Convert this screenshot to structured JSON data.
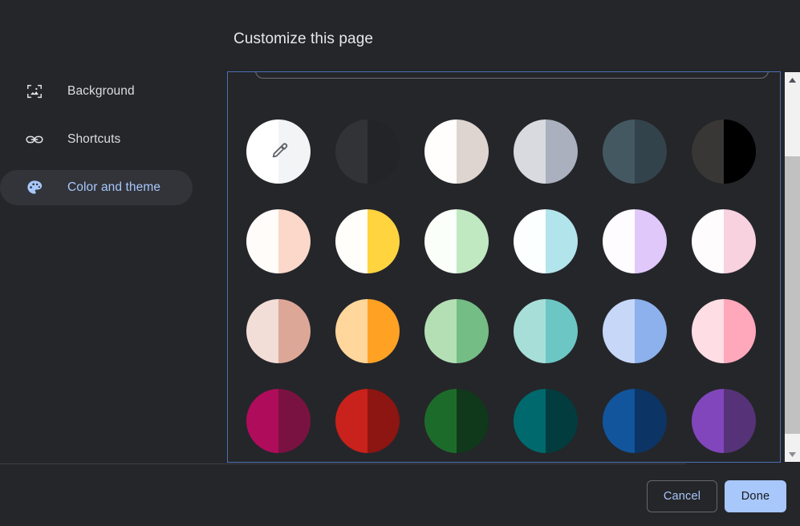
{
  "dialog": {
    "title": "Customize this page",
    "background": "#25262a"
  },
  "sidebar": {
    "items": [
      {
        "label": "Background",
        "icon": "image-frame-icon",
        "selected": false
      },
      {
        "label": "Shortcuts",
        "icon": "link-icon",
        "selected": false
      },
      {
        "label": "Color and theme",
        "icon": "palette-icon",
        "selected": true
      }
    ]
  },
  "swatches": {
    "accent_color": "#a8c7fa",
    "rows": [
      [
        {
          "name": "custom-color-picker",
          "left": "#ffffff",
          "right": "#f3f4f6",
          "icon": "eyedropper-icon",
          "outlined": false
        },
        {
          "name": "dark-grey-theme",
          "left": "#313337",
          "right": "#232428",
          "icon": "",
          "outlined": false
        },
        {
          "name": "white-beige-theme",
          "left": "#fffefd",
          "right": "#ded5d0",
          "icon": "",
          "outlined": false
        },
        {
          "name": "light-grey-theme",
          "left": "#d8dae0",
          "right": "#aab0bd",
          "icon": "",
          "outlined": false
        },
        {
          "name": "slate-blue-theme",
          "left": "#445862",
          "right": "#33434c",
          "icon": "",
          "outlined": false
        },
        {
          "name": "black-theme",
          "left": "#383735",
          "right": "#000000",
          "icon": "",
          "outlined": true
        }
      ],
      [
        {
          "name": "blush-white-theme",
          "left": "#fffcfa",
          "right": "#fbd8c9",
          "icon": "",
          "outlined": false
        },
        {
          "name": "yellow-theme",
          "left": "#fffefa",
          "right": "#ffd43f",
          "icon": "",
          "outlined": false
        },
        {
          "name": "mint-theme",
          "left": "#fbfff9",
          "right": "#c0e8c1",
          "icon": "",
          "outlined": false
        },
        {
          "name": "cyan-theme",
          "left": "#fbffff",
          "right": "#b2e4ec",
          "icon": "",
          "outlined": false
        },
        {
          "name": "lavender-theme",
          "left": "#fefcff",
          "right": "#e0c8fb",
          "icon": "",
          "outlined": false
        },
        {
          "name": "pale-pink-theme",
          "left": "#fffcfd",
          "right": "#f8d2de",
          "icon": "",
          "outlined": false
        }
      ],
      [
        {
          "name": "rose-theme",
          "left": "#f3ddd7",
          "right": "#dda797",
          "icon": "",
          "outlined": false
        },
        {
          "name": "orange-theme",
          "left": "#ffd69c",
          "right": "#ffa224",
          "icon": "",
          "outlined": false
        },
        {
          "name": "green-theme",
          "left": "#b4dfb5",
          "right": "#74bd85",
          "icon": "",
          "outlined": false
        },
        {
          "name": "teal-theme",
          "left": "#a8ded8",
          "right": "#6cc6c4",
          "icon": "",
          "outlined": false
        },
        {
          "name": "periwinkle-theme",
          "left": "#c6d7f8",
          "right": "#8cb1ec",
          "icon": "",
          "outlined": false
        },
        {
          "name": "pink-theme",
          "left": "#ffdde4",
          "right": "#ffa8bb",
          "icon": "",
          "outlined": false
        }
      ],
      [
        {
          "name": "magenta-theme",
          "left": "#b00c5c",
          "right": "#7a1241",
          "icon": "",
          "outlined": false
        },
        {
          "name": "red-theme",
          "left": "#c9211b",
          "right": "#8d1512",
          "icon": "",
          "outlined": false
        },
        {
          "name": "forest-green-theme",
          "left": "#1d6b2b",
          "right": "#10381b",
          "icon": "",
          "outlined": false
        },
        {
          "name": "dark-teal-theme",
          "left": "#00696d",
          "right": "#023c3e",
          "icon": "",
          "outlined": false
        },
        {
          "name": "blue-theme",
          "left": "#12559c",
          "right": "#0c3566",
          "icon": "",
          "outlined": false
        },
        {
          "name": "purple-theme",
          "left": "#8146bb",
          "right": "#563378",
          "icon": "",
          "outlined": false
        }
      ]
    ]
  },
  "scrollbar": {
    "up_arrow": "scroll-up-arrow",
    "down_arrow": "scroll-down-arrow",
    "track_color": "#f1f1f1",
    "thumb_color": "#c1c1c1"
  },
  "footer": {
    "cancel_label": "Cancel",
    "done_label": "Done"
  }
}
